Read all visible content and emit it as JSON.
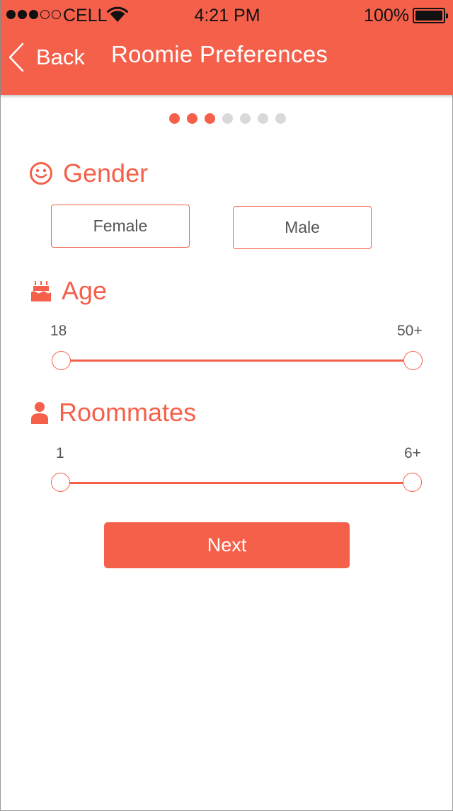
{
  "status_bar": {
    "carrier": "CELL",
    "time": "4:21 PM",
    "battery": "100%",
    "signal_bars": 3,
    "signal_total": 5,
    "icons": [
      "signal-icon",
      "wifi-icon",
      "battery-icon"
    ]
  },
  "nav": {
    "back_label": "Back",
    "title": "Roomie Preferences",
    "back_icon": "chevron-left-icon"
  },
  "progress": {
    "current": 3,
    "total": 7
  },
  "gender": {
    "title": "Gender",
    "icon": "smiley-icon",
    "options": [
      "Female",
      "Male"
    ]
  },
  "age": {
    "title": "Age",
    "icon": "cake-icon",
    "min_label": "18",
    "max_label": "50+",
    "range": [
      0,
      1
    ]
  },
  "roommates": {
    "title": "Roommates",
    "icon": "person-icon",
    "min_label": "1",
    "max_label": "6+",
    "range": [
      0,
      1
    ]
  },
  "actions": {
    "next_label": "Next"
  },
  "colors": {
    "accent": "#f5604b",
    "inactive_dot": "#d9d9d9",
    "text": "#555555"
  }
}
